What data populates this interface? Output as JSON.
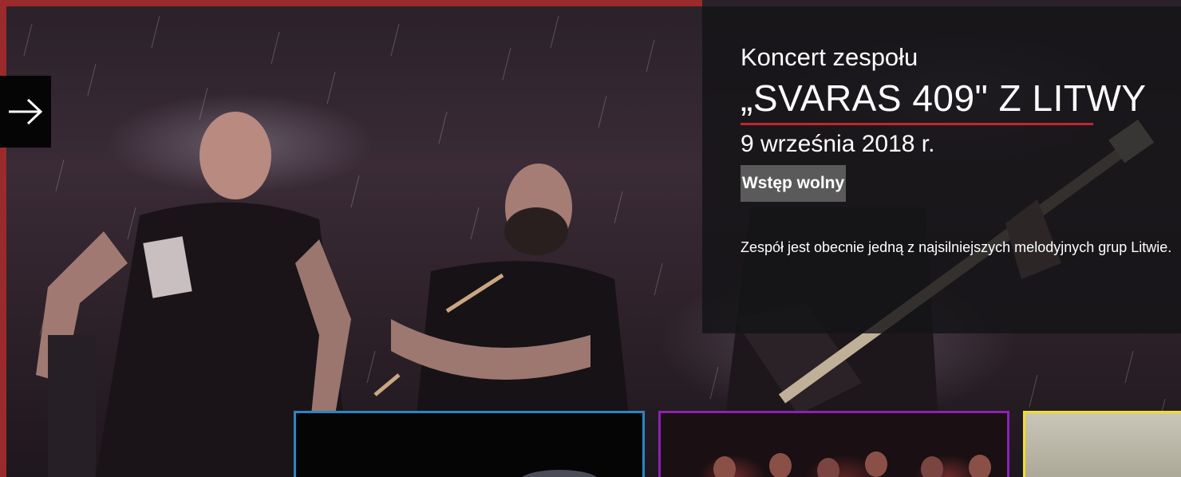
{
  "slide": {
    "overline": "Koncert zespołu",
    "headline": "„SVARAS 409\" Z LITWY",
    "date": "9 września 2018 r.",
    "badge": "Wstęp wolny",
    "description": "Zespół jest obecnie jedną z najsilniejszych melodyjnych grup Litwie."
  },
  "controls": {
    "next_icon": "arrow-right-icon"
  },
  "tiles": [
    {
      "name": "tile-1",
      "border_color": "#2a86c4"
    },
    {
      "name": "tile-2",
      "border_color": "#8c21b5"
    },
    {
      "name": "tile-3",
      "border_color": "#f0e020"
    }
  ],
  "colors": {
    "accent": "#c0272d",
    "frame": "#9b2a2d",
    "badge_bg": "#5a5a5a",
    "panel_bg": "#141416"
  }
}
